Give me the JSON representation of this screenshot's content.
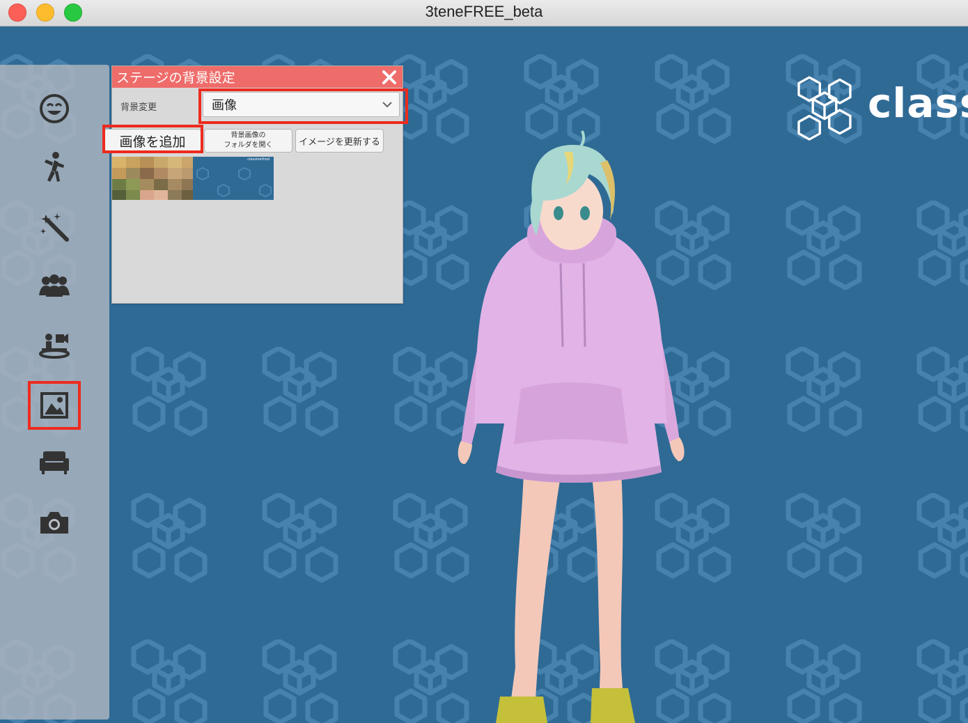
{
  "window": {
    "title": "3teneFREE_beta"
  },
  "brand": {
    "text": "class"
  },
  "sidebar": {
    "items": [
      {
        "name": "face-icon",
        "active": false
      },
      {
        "name": "pose-icon",
        "active": false
      },
      {
        "name": "effects-icon",
        "active": false
      },
      {
        "name": "people-icon",
        "active": false
      },
      {
        "name": "camera-setup-icon",
        "active": false
      },
      {
        "name": "image-icon",
        "active": true
      },
      {
        "name": "sofa-icon",
        "active": false
      },
      {
        "name": "camera-icon",
        "active": false
      }
    ]
  },
  "panel": {
    "title": "ステージの背景設定",
    "bg_change_label": "背景変更",
    "select_value": "画像",
    "add_image_label": "画像を追加",
    "open_folder_line1": "背景画像の",
    "open_folder_line2": "フォルダを開く",
    "refresh_label": "イメージを更新する",
    "thumb2_caption": "classmethod"
  },
  "colors": {
    "highlight": "#ec2b1e",
    "panel_header": "#ee6c6a",
    "stage_bg": "#2f6a95"
  }
}
